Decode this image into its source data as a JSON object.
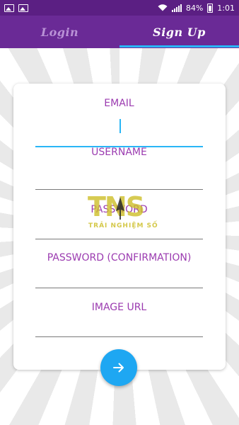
{
  "status_bar": {
    "battery": "84%",
    "time": "1:01",
    "icons": [
      "image-icon",
      "image-icon",
      "wifi-icon",
      "signal-icon",
      "battery-icon"
    ]
  },
  "tabs": [
    {
      "label": "Login",
      "active": false
    },
    {
      "label": "Sign Up",
      "active": true
    }
  ],
  "form": {
    "email_label": "EMAIL",
    "username_label": "USERNAME",
    "password_label": "PASSWORD",
    "password_confirm_label": "PASSWORD (CONFIRMATION)",
    "image_url_label": "IMAGE URL"
  },
  "watermark": {
    "logo": "TNS",
    "tagline": "TRẢI NGHIỆM SỐ"
  },
  "submit_button": {
    "icon": "arrow-right-icon"
  },
  "colors": {
    "header": "#6a2a96",
    "status_bar": "#5b1f83",
    "accent": "#29b6f6",
    "label": "#9b3bb0",
    "fab": "#1ea7f2"
  }
}
